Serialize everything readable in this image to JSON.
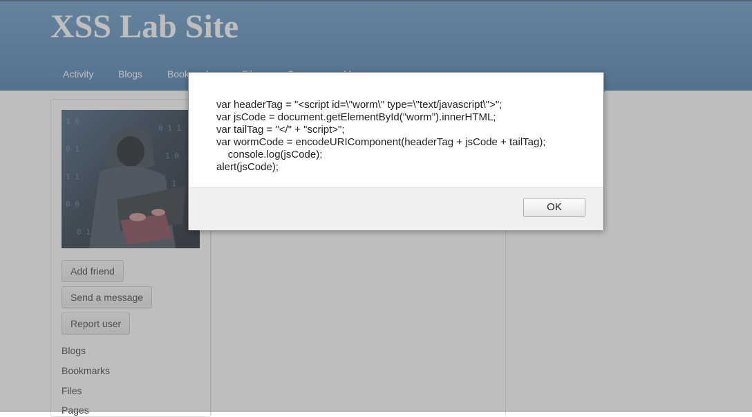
{
  "site": {
    "title": "XSS Lab Site"
  },
  "nav": {
    "items": [
      {
        "label": "Activity"
      },
      {
        "label": "Blogs"
      },
      {
        "label": "Bookmarks"
      },
      {
        "label": "Files"
      },
      {
        "label": "Groups"
      },
      {
        "label": "More"
      }
    ]
  },
  "profile": {
    "buttons": {
      "add_friend": "Add friend",
      "send_message": "Send a message",
      "report_user": "Report user"
    },
    "links": [
      "Blogs",
      "Bookmarks",
      "Files",
      "Pages"
    ]
  },
  "dialog": {
    "message_lines": [
      "var headerTag = \"<script id=\\\"worm\\\" type=\\\"text/javascript\\\">\";",
      "var jsCode = document.getElementById(\"worm\").innerHTML;",
      "var tailTag = \"</\" + \"script>\";",
      "var wormCode = encodeURIComponent(headerTag + jsCode + tailTag);",
      "    console.log(jsCode);",
      "alert(jsCode);"
    ],
    "ok_label": "OK"
  },
  "colors": {
    "header": "#4a7fb3",
    "navbar": "#3e72a6",
    "overlay": "rgba(110,110,110,0.45)"
  }
}
